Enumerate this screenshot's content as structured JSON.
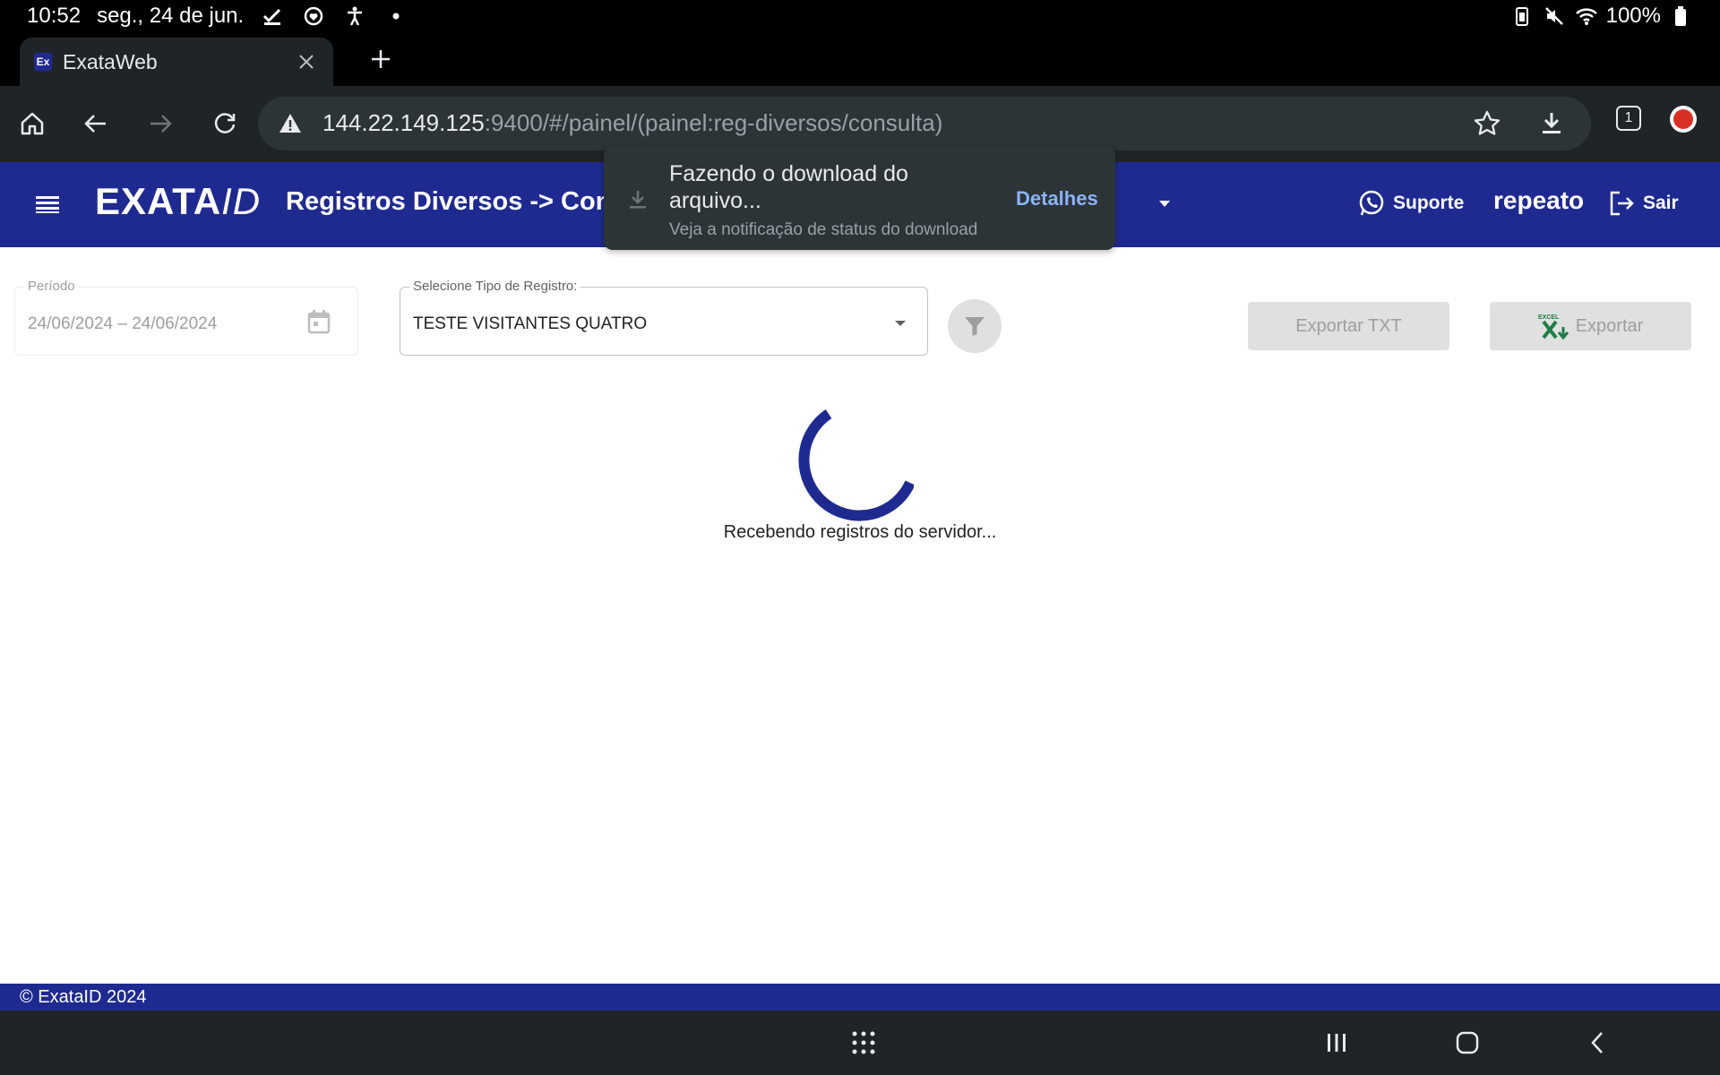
{
  "status_bar": {
    "time": "10:52",
    "date": "seg., 24 de jun.",
    "battery": "100%"
  },
  "browser": {
    "tab_title": "ExataWeb",
    "tab_favicon": "Ex",
    "url_host": "144.22.149.125",
    "url_rest": ":9400/#/painel/(painel:reg-diversos/consulta)",
    "tab_count": "1"
  },
  "app": {
    "logo_main": "EXATA",
    "logo_id": "ID",
    "page_title": "Registros Diversos -> Cons",
    "support_label": "Suporte",
    "username": "repeato",
    "logout_label": "Sair",
    "brand_color": "#1f2a90"
  },
  "download_toast": {
    "title": "Fazendo o download do arquivo...",
    "subtitle": "Veja a notificação de status do download",
    "link": "Detalhes"
  },
  "filters": {
    "period_label": "Período",
    "period_value": "24/06/2024 – 24/06/2024",
    "type_label": "Selecione Tipo de Registro:",
    "type_value": "TESTE VISITANTES QUATRO"
  },
  "actions": {
    "export_txt": "Exportar TXT",
    "export_xls": "Exportar",
    "excel_icon_text": "EXCEL"
  },
  "loader": {
    "text": "Recebendo registros do servidor..."
  },
  "footer": {
    "text": "© ExataID 2024"
  }
}
